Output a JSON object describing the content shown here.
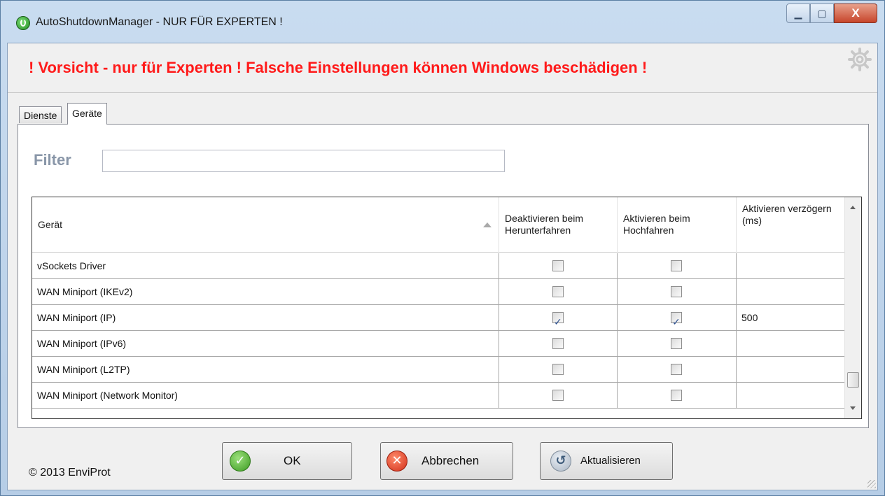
{
  "window": {
    "title": "AutoShutdownManager - NUR FÜR EXPERTEN !",
    "controls": {
      "minimize": "▁",
      "maximize": "▢",
      "close": "X"
    }
  },
  "banner": {
    "warning": "! Vorsicht - nur für Experten !  Falsche Einstellungen können Windows beschädigen  !",
    "icon": "gear-icon"
  },
  "tabs": [
    {
      "label": "Dienste",
      "active": false
    },
    {
      "label": "Geräte",
      "active": true
    }
  ],
  "filter": {
    "label": "Filter",
    "value": ""
  },
  "grid": {
    "columns": [
      "Gerät",
      "Deaktivieren beim Herunterfahren",
      "Aktivieren beim Hochfahren",
      "Aktivieren verzögern (ms)"
    ],
    "rows": [
      {
        "device": "vSockets Driver",
        "deactivate": false,
        "activate": false,
        "delay": ""
      },
      {
        "device": "WAN Miniport (IKEv2)",
        "deactivate": false,
        "activate": false,
        "delay": ""
      },
      {
        "device": "WAN Miniport (IP)",
        "deactivate": true,
        "activate": true,
        "delay": "500"
      },
      {
        "device": "WAN Miniport (IPv6)",
        "deactivate": false,
        "activate": false,
        "delay": ""
      },
      {
        "device": "WAN Miniport (L2TP)",
        "deactivate": false,
        "activate": false,
        "delay": ""
      },
      {
        "device": "WAN Miniport (Network Monitor)",
        "deactivate": false,
        "activate": false,
        "delay": ""
      }
    ],
    "scroll_position": 0.85
  },
  "buttons": {
    "ok": "OK",
    "cancel": "Abbrechen",
    "refresh": "Aktualisieren"
  },
  "footer": {
    "copyright": "© 2013 EnviProt"
  },
  "colors": {
    "warning": "#ff1a1a",
    "filter_label": "#8996a8"
  }
}
